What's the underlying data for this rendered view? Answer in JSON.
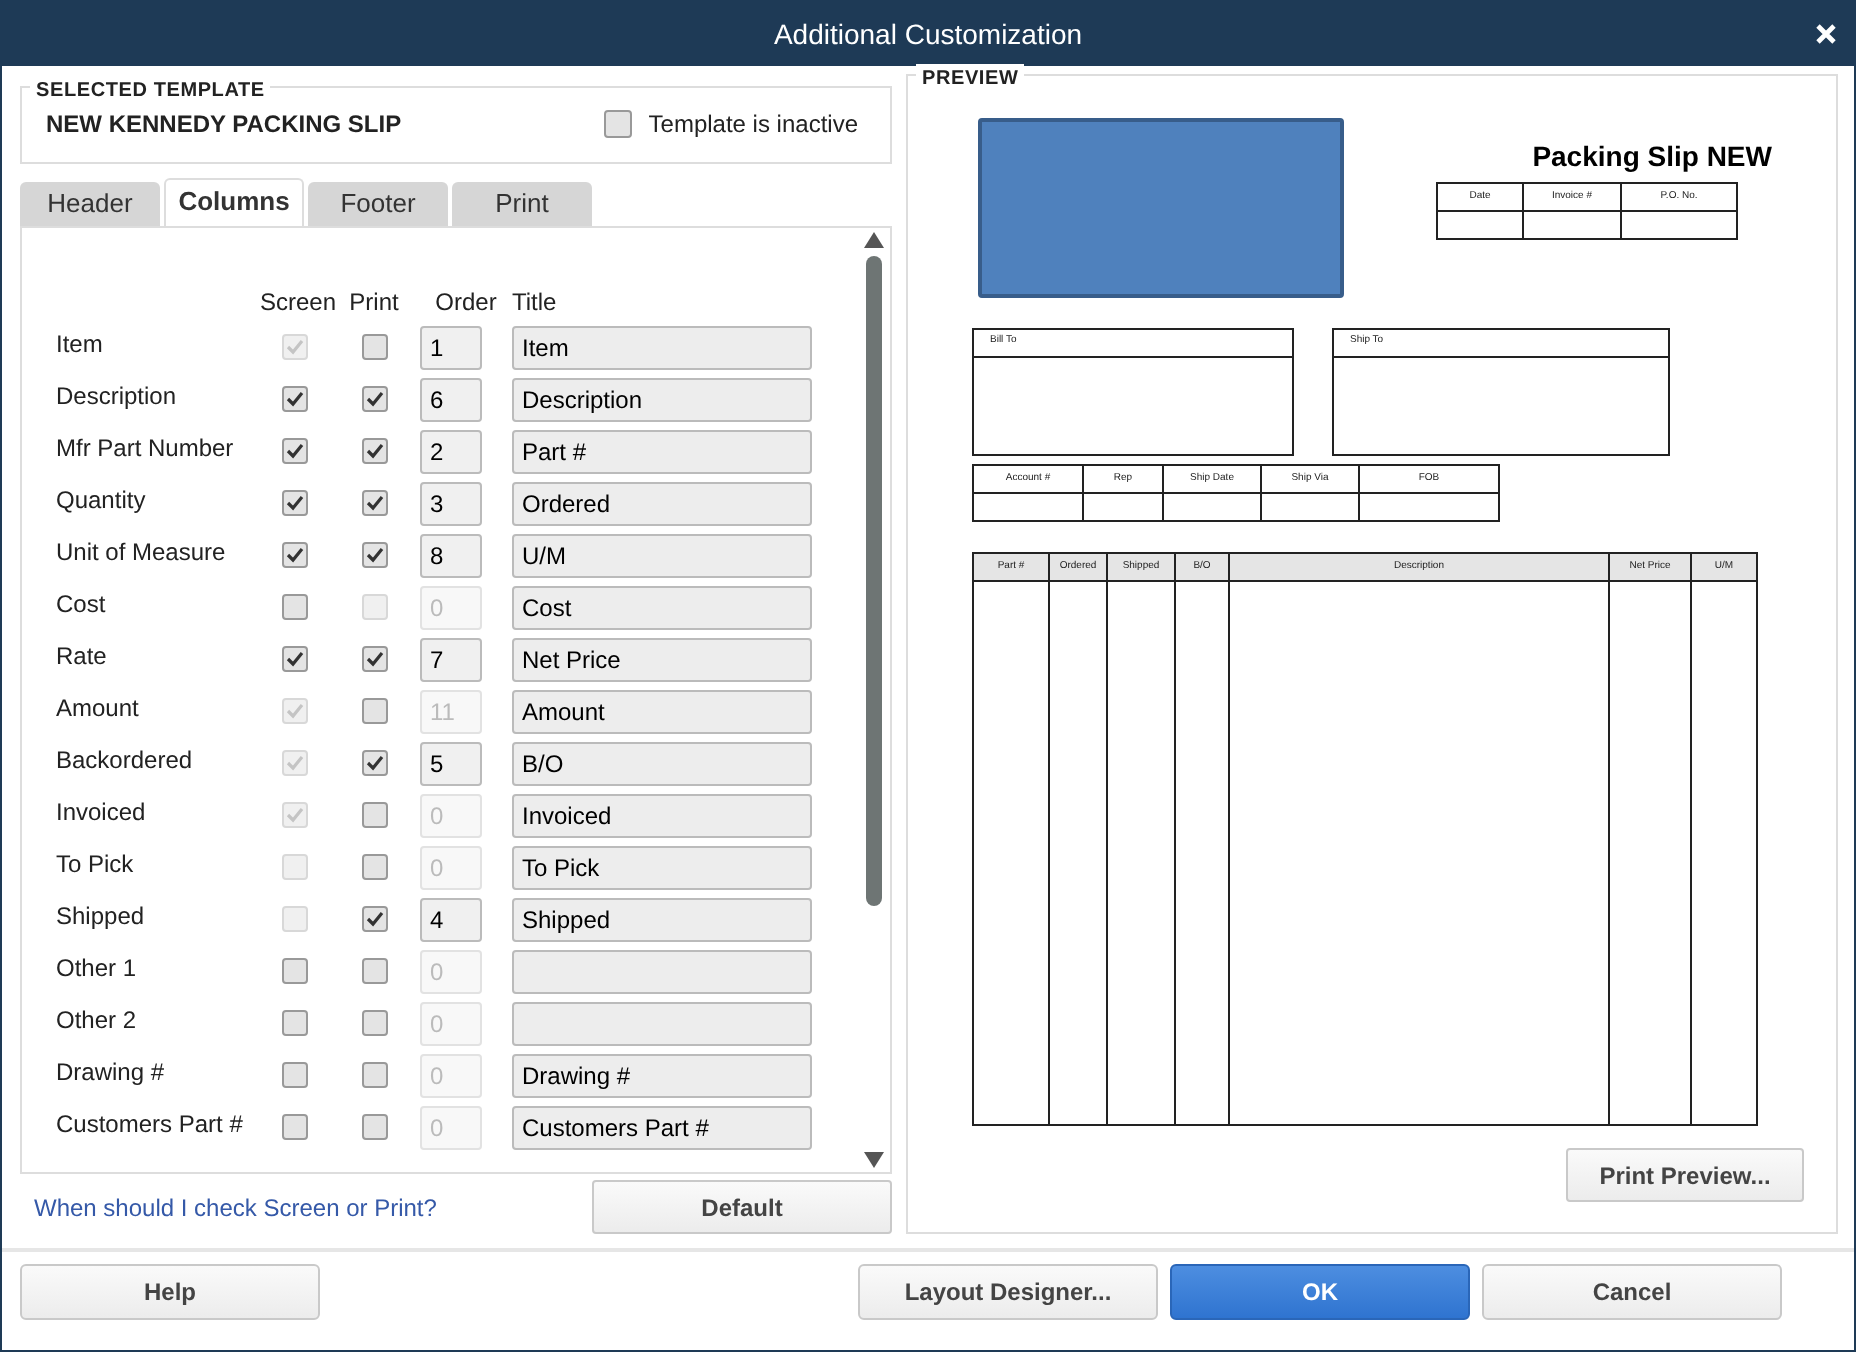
{
  "window": {
    "title": "Additional Customization"
  },
  "selected_template": {
    "label": "SELECTED TEMPLATE",
    "name": "NEW KENNEDY PACKING SLIP",
    "inactive": {
      "label": "Template is inactive",
      "checked": false
    }
  },
  "tabs": [
    {
      "label": "Header",
      "selected": false
    },
    {
      "label": "Columns",
      "selected": true
    },
    {
      "label": "Footer",
      "selected": false
    },
    {
      "label": "Print",
      "selected": false
    }
  ],
  "columns": {
    "headers": [
      "Screen",
      "Print",
      "Order",
      "Title"
    ],
    "rows": [
      {
        "name": "Item",
        "screen": {
          "checked": true,
          "disabled": true
        },
        "print": {
          "checked": false,
          "disabled": false
        },
        "order": {
          "value": "1",
          "disabled": false
        },
        "title": "Item"
      },
      {
        "name": "Description",
        "screen": {
          "checked": true,
          "disabled": false
        },
        "print": {
          "checked": true,
          "disabled": false
        },
        "order": {
          "value": "6",
          "disabled": false
        },
        "title": "Description"
      },
      {
        "name": "Mfr Part Number",
        "screen": {
          "checked": true,
          "disabled": false
        },
        "print": {
          "checked": true,
          "disabled": false
        },
        "order": {
          "value": "2",
          "disabled": false
        },
        "title": "Part #"
      },
      {
        "name": "Quantity",
        "screen": {
          "checked": true,
          "disabled": false
        },
        "print": {
          "checked": true,
          "disabled": false
        },
        "order": {
          "value": "3",
          "disabled": false
        },
        "title": "Ordered"
      },
      {
        "name": "Unit of Measure",
        "screen": {
          "checked": true,
          "disabled": false
        },
        "print": {
          "checked": true,
          "disabled": false
        },
        "order": {
          "value": "8",
          "disabled": false
        },
        "title": "U/M"
      },
      {
        "name": "Cost",
        "screen": {
          "checked": false,
          "disabled": false
        },
        "print": {
          "checked": false,
          "disabled": true
        },
        "order": {
          "value": "0",
          "disabled": true
        },
        "title": "Cost"
      },
      {
        "name": "Rate",
        "screen": {
          "checked": true,
          "disabled": false
        },
        "print": {
          "checked": true,
          "disabled": false
        },
        "order": {
          "value": "7",
          "disabled": false
        },
        "title": "Net Price"
      },
      {
        "name": "Amount",
        "screen": {
          "checked": true,
          "disabled": true
        },
        "print": {
          "checked": false,
          "disabled": false
        },
        "order": {
          "value": "11",
          "disabled": true
        },
        "title": "Amount"
      },
      {
        "name": "Backordered",
        "screen": {
          "checked": true,
          "disabled": true
        },
        "print": {
          "checked": true,
          "disabled": false
        },
        "order": {
          "value": "5",
          "disabled": false
        },
        "title": "B/O"
      },
      {
        "name": "Invoiced",
        "screen": {
          "checked": true,
          "disabled": true
        },
        "print": {
          "checked": false,
          "disabled": false
        },
        "order": {
          "value": "0",
          "disabled": true
        },
        "title": "Invoiced"
      },
      {
        "name": "To Pick",
        "screen": {
          "checked": false,
          "disabled": true
        },
        "print": {
          "checked": false,
          "disabled": false
        },
        "order": {
          "value": "0",
          "disabled": true
        },
        "title": "To Pick"
      },
      {
        "name": "Shipped",
        "screen": {
          "checked": false,
          "disabled": true
        },
        "print": {
          "checked": true,
          "disabled": false
        },
        "order": {
          "value": "4",
          "disabled": false
        },
        "title": "Shipped"
      },
      {
        "name": "Other 1",
        "screen": {
          "checked": false,
          "disabled": false
        },
        "print": {
          "checked": false,
          "disabled": false
        },
        "order": {
          "value": "0",
          "disabled": true
        }
      },
      {
        "name": "Other 2",
        "screen": {
          "checked": false,
          "disabled": false
        },
        "print": {
          "checked": false,
          "disabled": false
        },
        "order": {
          "value": "0",
          "disabled": true
        }
      },
      {
        "name": "Drawing #",
        "screen": {
          "checked": false,
          "disabled": false
        },
        "print": {
          "checked": false,
          "disabled": false
        },
        "order": {
          "value": "0",
          "disabled": true
        },
        "title": "Drawing #"
      },
      {
        "name": "Customers Part #",
        "screen": {
          "checked": false,
          "disabled": false
        },
        "print": {
          "checked": false,
          "disabled": false
        },
        "order": {
          "value": "0",
          "disabled": true
        },
        "title": "Customers Part #"
      }
    ]
  },
  "help_link": "When should I check Screen or Print?",
  "default_button": "Default",
  "preview": {
    "label": "PREVIEW",
    "document": {
      "title": "Packing Slip NEW",
      "info_table": [
        "Date",
        "Invoice #",
        "P.O. No."
      ],
      "bill_to": "Bill To",
      "ship_to": "Ship To",
      "account_table": [
        "Account #",
        "Rep",
        "Ship Date",
        "Ship Via",
        "FOB"
      ],
      "items_table": [
        "Part #",
        "Ordered",
        "Shipped",
        "B/O",
        "Description",
        "Net Price",
        "U/M"
      ]
    },
    "print_preview_button": "Print Preview..."
  },
  "buttons": [
    {
      "label": "Help",
      "primary": false
    },
    {
      "label": "Layout Designer...",
      "primary": false
    },
    {
      "label": "OK",
      "primary": true
    },
    {
      "label": "Cancel",
      "primary": false
    }
  ]
}
